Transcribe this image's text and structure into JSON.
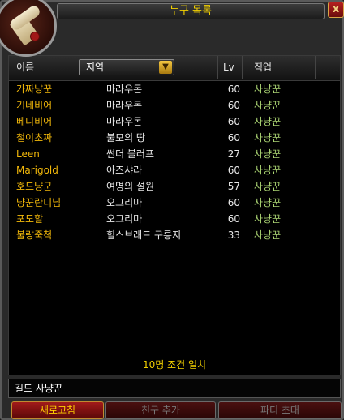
{
  "window": {
    "title": "누구 목록",
    "close_label": "x"
  },
  "columns": {
    "name": "이름",
    "zone": "지역",
    "level": "Lv",
    "class": "직업"
  },
  "zone_dropdown": {
    "arrow_icon": "dropdown-arrow-icon"
  },
  "rows": [
    {
      "name": "가짜냥꾼",
      "zone": "마라우돈",
      "level": "60",
      "class": "사냥꾼"
    },
    {
      "name": "기네비어",
      "zone": "마라우돈",
      "level": "60",
      "class": "사냥꾼"
    },
    {
      "name": "베디비어",
      "zone": "마라우돈",
      "level": "60",
      "class": "사냥꾼"
    },
    {
      "name": "철이초짜",
      "zone": "불모의 땅",
      "level": "60",
      "class": "사냥꾼"
    },
    {
      "name": "Leen",
      "zone": "썬더 블러프",
      "level": "27",
      "class": "사냥꾼"
    },
    {
      "name": "Marigold",
      "zone": "아즈샤라",
      "level": "60",
      "class": "사냥꾼"
    },
    {
      "name": "호드냥군",
      "zone": "여명의 설원",
      "level": "57",
      "class": "사냥꾼"
    },
    {
      "name": "냥꾼란니님",
      "zone": "오그리마",
      "level": "60",
      "class": "사냥꾼"
    },
    {
      "name": "포도할",
      "zone": "오그리마",
      "level": "60",
      "class": "사냥꾼"
    },
    {
      "name": "불량죽척",
      "zone": "힐스브래드 구릉지",
      "level": "33",
      "class": "사냥꾼"
    }
  ],
  "summary": "10명 조건 일치",
  "search": {
    "value": "길드 사냥꾼"
  },
  "buttons": {
    "refresh": "새로고침",
    "add_friend": "친구 추가",
    "party_invite": "파티 초대"
  },
  "colors": {
    "name": "#f2b80a",
    "class": "#aad372",
    "title": "#f2d000"
  }
}
